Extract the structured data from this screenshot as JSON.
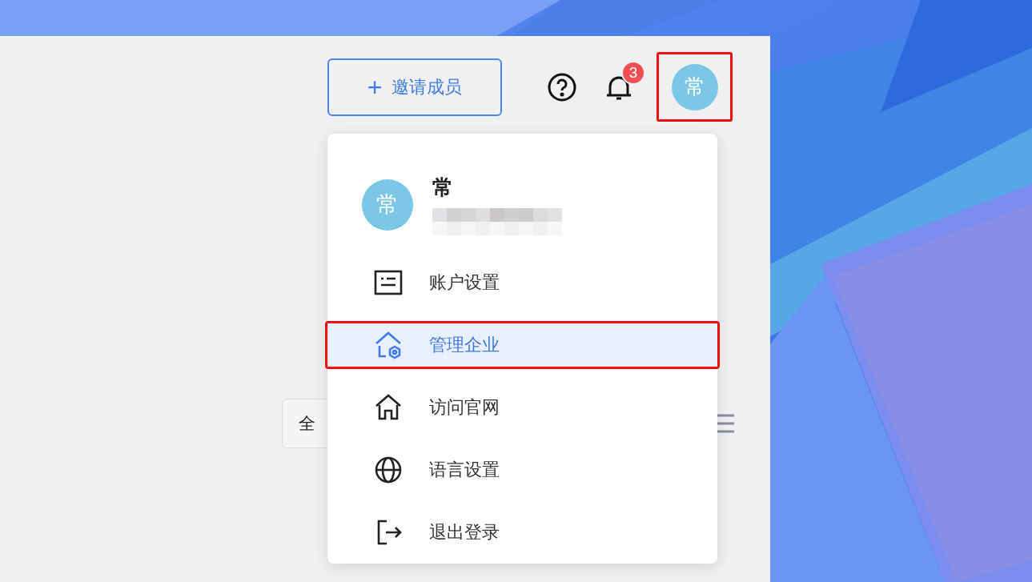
{
  "header": {
    "invite_button": {
      "icon": "+",
      "label": "邀请成员"
    },
    "notifications": {
      "badge": "3"
    },
    "avatar": {
      "initial": "常",
      "highlighted": true
    }
  },
  "filter": {
    "value": "全"
  },
  "user_menu": {
    "avatar_initial": "常",
    "name": "常",
    "items": [
      {
        "kind": "account",
        "label": "账户设置",
        "selected": false,
        "highlighted": false
      },
      {
        "kind": "company",
        "label": "管理企业",
        "selected": true,
        "highlighted": true
      },
      {
        "kind": "website",
        "label": "访问官网",
        "selected": false,
        "highlighted": false
      },
      {
        "kind": "language",
        "label": "语言设置",
        "selected": false,
        "highlighted": false
      },
      {
        "kind": "logout",
        "label": "退出登录",
        "selected": false,
        "highlighted": false
      }
    ]
  }
}
